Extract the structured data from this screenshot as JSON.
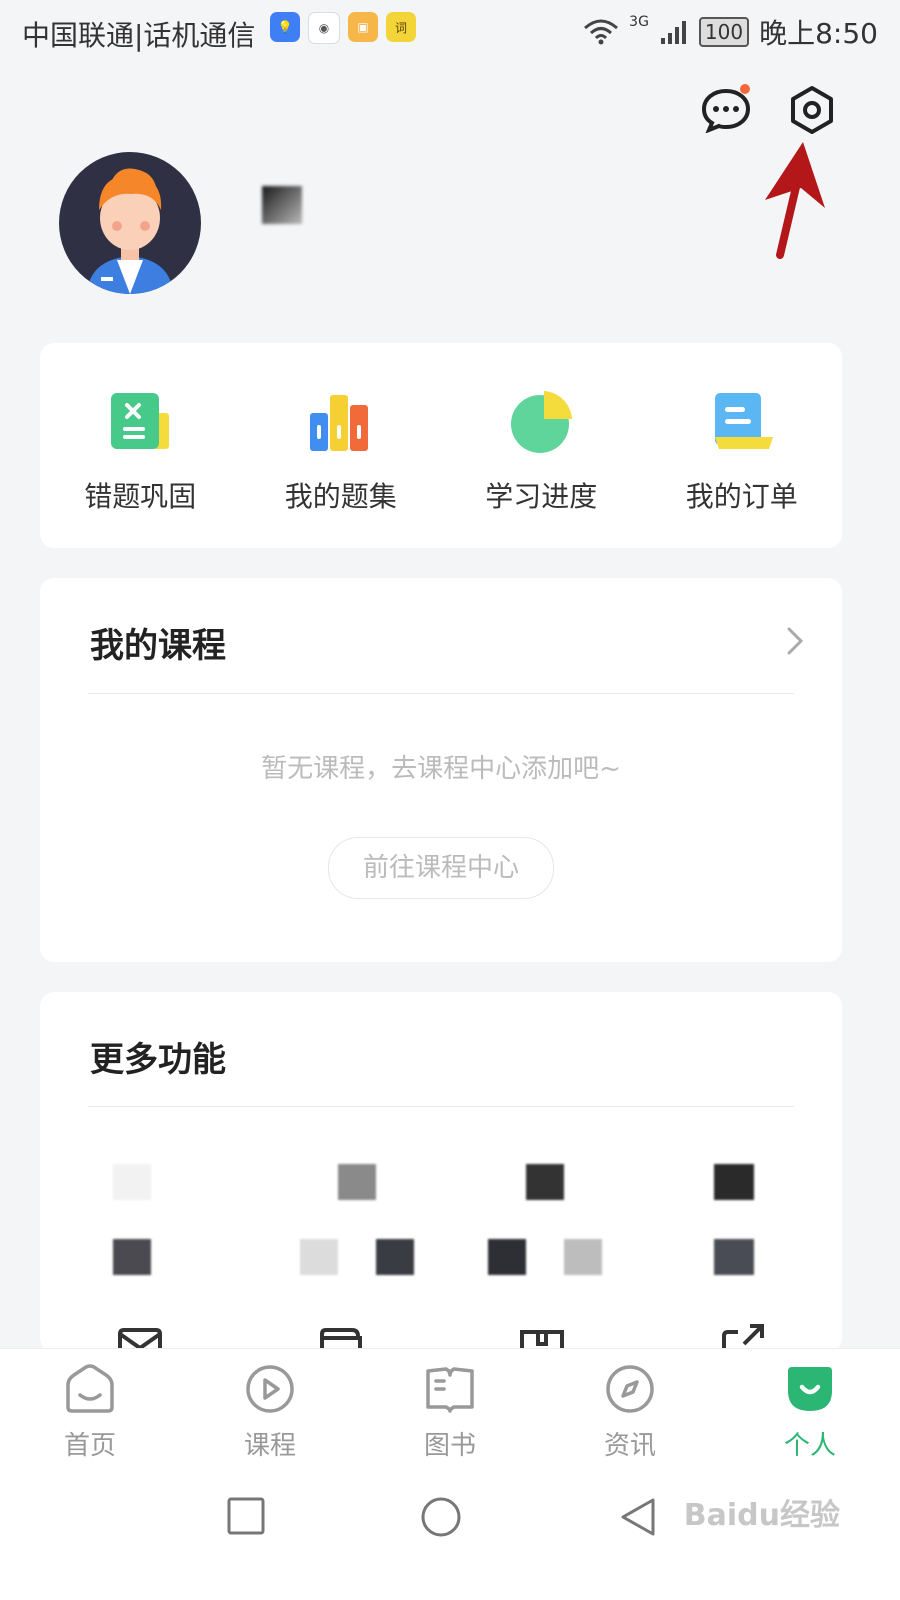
{
  "status_bar": {
    "carrier": "中国联通|话机通信",
    "network": "3G",
    "battery": "100",
    "time": "晚上8:50"
  },
  "header": {
    "messages_icon": "chat-bubble-icon",
    "settings_icon": "settings-hexagon-icon",
    "has_unread": true
  },
  "quick_actions": [
    {
      "label": "错题巩固",
      "icon": "wrong-question-icon"
    },
    {
      "label": "我的题集",
      "icon": "question-set-icon"
    },
    {
      "label": "学习进度",
      "icon": "progress-pie-icon"
    },
    {
      "label": "我的订单",
      "icon": "order-icon"
    }
  ],
  "courses": {
    "title": "我的课程",
    "empty_text": "暂无课程，去课程中心添加吧~",
    "go_button": "前往课程中心"
  },
  "more": {
    "title": "更多功能"
  },
  "tabs": [
    {
      "label": "首页",
      "icon": "home-icon",
      "active": false
    },
    {
      "label": "课程",
      "icon": "play-circle-icon",
      "active": false
    },
    {
      "label": "图书",
      "icon": "book-icon",
      "active": false
    },
    {
      "label": "资讯",
      "icon": "compass-icon",
      "active": false
    },
    {
      "label": "个人",
      "icon": "person-icon",
      "active": true
    }
  ],
  "watermark": "Baidu经验",
  "colors": {
    "accent": "#2bb673",
    "background": "#f4f5f7",
    "notification_dot": "#f4683a"
  }
}
